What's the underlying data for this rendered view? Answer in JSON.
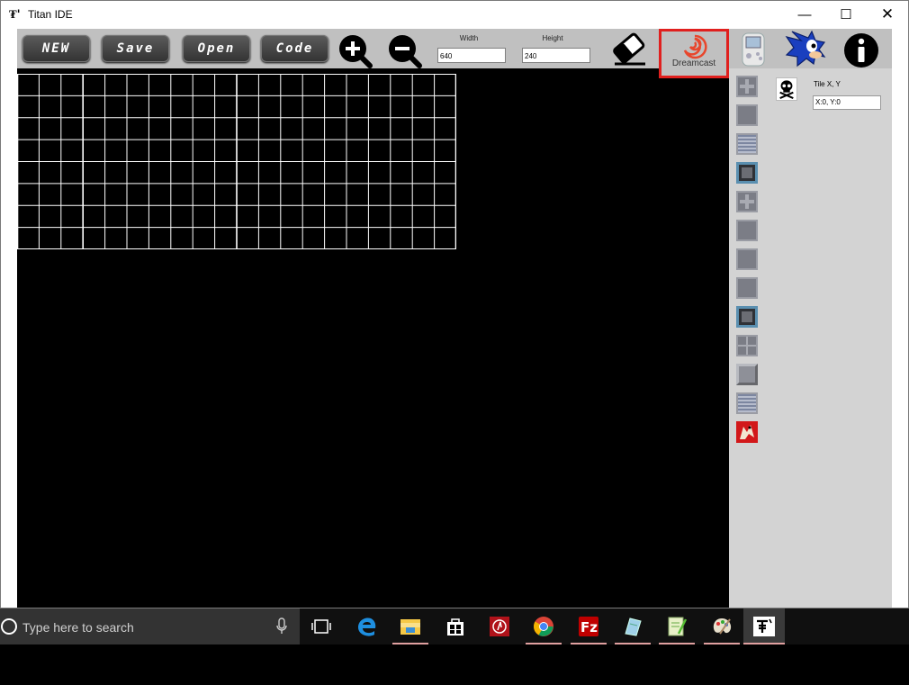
{
  "window": {
    "title": "Titan IDE",
    "app_icon_glyph": "₮'",
    "minimize_glyph": "—",
    "maximize_glyph": "☐",
    "close_glyph": "✕"
  },
  "toolbar": {
    "new_label": "NEW",
    "save_label": "Save",
    "open_label": "Open",
    "code_label": "Code",
    "zoom_in_icon": "zoom-in-icon",
    "zoom_out_icon": "zoom-out-icon",
    "width_label": "Width",
    "width_value": "640",
    "height_label": "Height",
    "height_value": "240",
    "eraser_icon": "eraser-icon",
    "platform_label": "Dreamcast",
    "vmu_icon": "vmu-icon",
    "sonic_icon": "sonic-icon",
    "info_icon": "info-icon"
  },
  "canvas": {
    "columns": 20,
    "rows": 8
  },
  "side_panel": {
    "tiles": [
      "tile-cross",
      "tile-gray",
      "tile-lines",
      "tile-frame",
      "tile-cross",
      "tile-gray",
      "tile-gray",
      "tile-gray",
      "tile-frame",
      "tile-grid",
      "tile-bevel",
      "tile-lines",
      "tile-red-sprite"
    ],
    "selected_icon": "skull-crossbones-icon",
    "tile_coord_label": "Tile X, Y",
    "tile_coord_value": "X:0, Y:0"
  },
  "taskbar": {
    "search_placeholder": "Type here to search",
    "apps": [
      "task-view",
      "edge",
      "file-explorer",
      "store",
      "app-red",
      "chrome",
      "filezilla",
      "notepad-app",
      "notepad-plus",
      "paint",
      "titan-ide"
    ]
  },
  "colors": {
    "highlight_box": "#e0201e",
    "toolbar_bg": "#c0c0c0",
    "panel_bg": "#d3d3d3",
    "sonic_blue": "#1a3fbf",
    "dreamcast_swirl": "#e8462c"
  }
}
